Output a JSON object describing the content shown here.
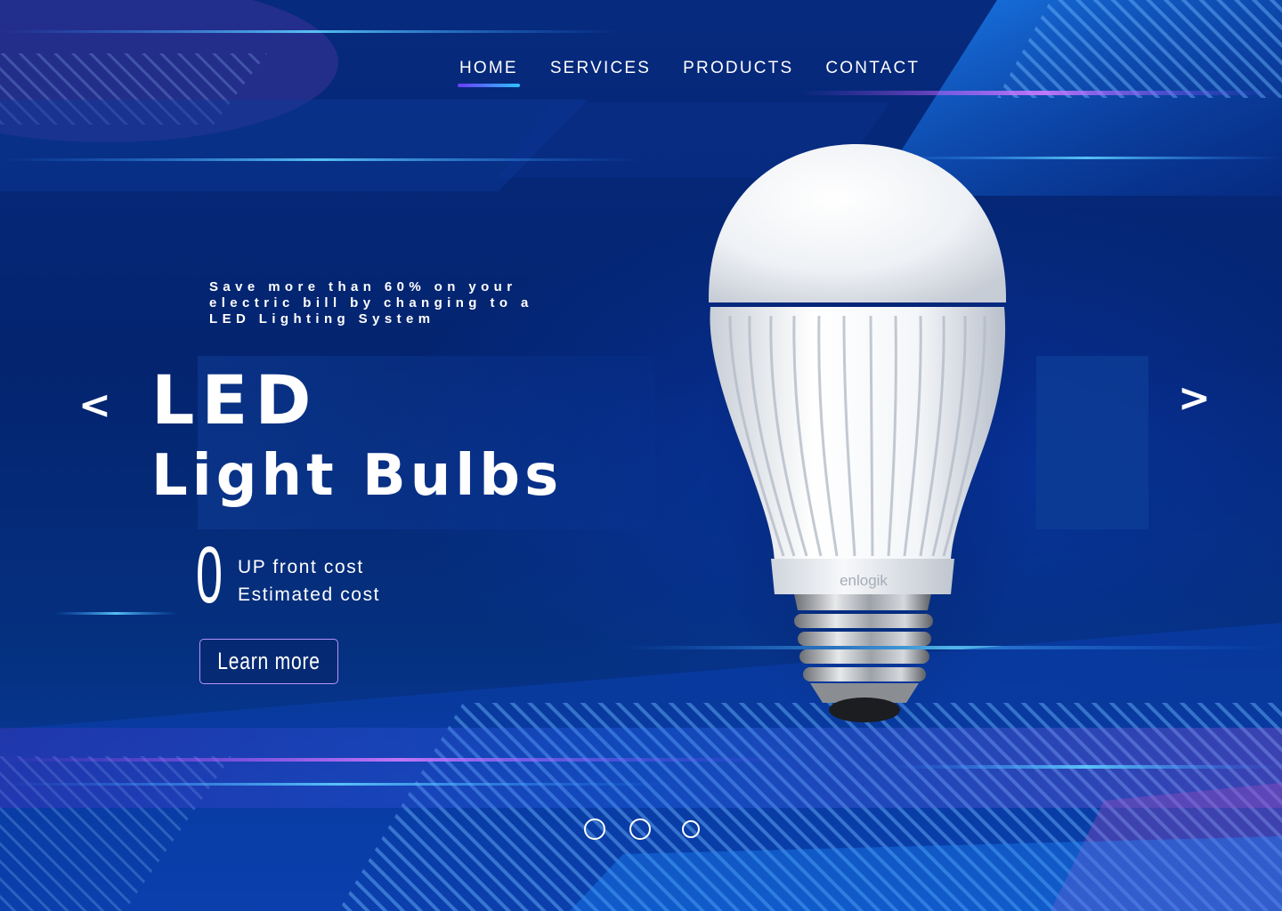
{
  "nav": {
    "items": [
      {
        "label": "HOME",
        "active": true
      },
      {
        "label": "SERVICES",
        "active": false
      },
      {
        "label": "PRODUCTS",
        "active": false
      },
      {
        "label": "CONTACT",
        "active": false
      }
    ]
  },
  "hero": {
    "tagline_lines": [
      "Save more than 60% on your",
      "electric bill by changing to a",
      "LED Lighting System"
    ],
    "title_line1": "LED",
    "title_line2": "Light Bulbs",
    "cost_value": "0",
    "cost_line1": "UP front cost",
    "cost_line2": "Estimated cost",
    "cta_label": "Learn more",
    "bulb_brand": "enlogik"
  },
  "carousel": {
    "prev_icon": "chevron-left-icon",
    "next_icon": "chevron-right-icon",
    "prev_glyph": "<",
    "next_glyph": ">",
    "slide_count": 3
  },
  "colors": {
    "background": "#04246f",
    "accent_underline_start": "#6a3cff",
    "accent_underline_end": "#2ec2ff",
    "button_border": "#b696ff",
    "text": "#ffffff"
  }
}
